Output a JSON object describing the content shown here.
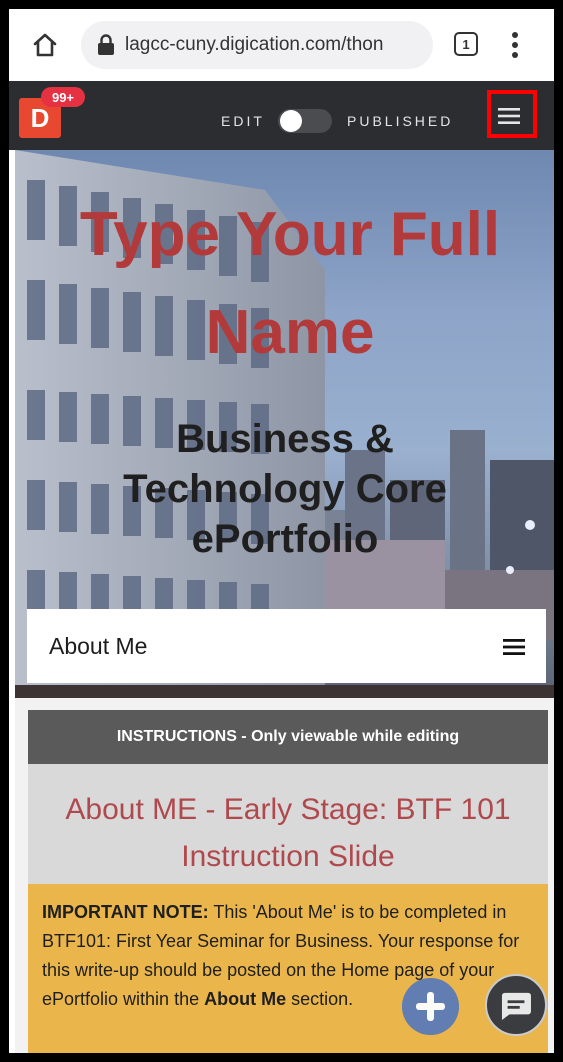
{
  "browser": {
    "url": "lagcc-cuny.digication.com/thon",
    "tab_count": "1"
  },
  "toolbar": {
    "logo_letter": "D",
    "notification_badge": "99+",
    "edit_label": "EDIT",
    "published_label": "PUBLISHED",
    "toggle_on": false
  },
  "hero": {
    "title": "Type Your Full Name",
    "subtitle": "Business & Technology Core ePortfolio"
  },
  "page_nav": {
    "label": "About Me"
  },
  "content": {
    "instructions_header": "INSTRUCTIONS - Only viewable while editing",
    "instructions_title": "About ME - Early Stage: BTF 101 Instruction Slide",
    "note": {
      "lead": "IMPORTANT NOTE:",
      "text_1": " This 'About Me' is to be completed in BTF101: First Year Seminar for Business. Your response for this write-up should be posted on the Home page of your ePortfolio within ",
      "text_2": "the ",
      "bold": "About Me",
      "text_3": " section."
    }
  },
  "colors": {
    "toolbar_bg": "#2b2d30",
    "logo": "#e8482f",
    "badge": "#e53142",
    "highlight": "#ff0000",
    "hero_title": "#b23a3a",
    "instructions_title": "#b0494d",
    "note_bg": "#eab64b"
  },
  "icons": {
    "home": "home-icon",
    "lock": "lock-icon",
    "more": "more-vertical-icon",
    "menu": "hamburger-menu-icon",
    "plus": "plus-icon",
    "chat": "chat-icon"
  }
}
